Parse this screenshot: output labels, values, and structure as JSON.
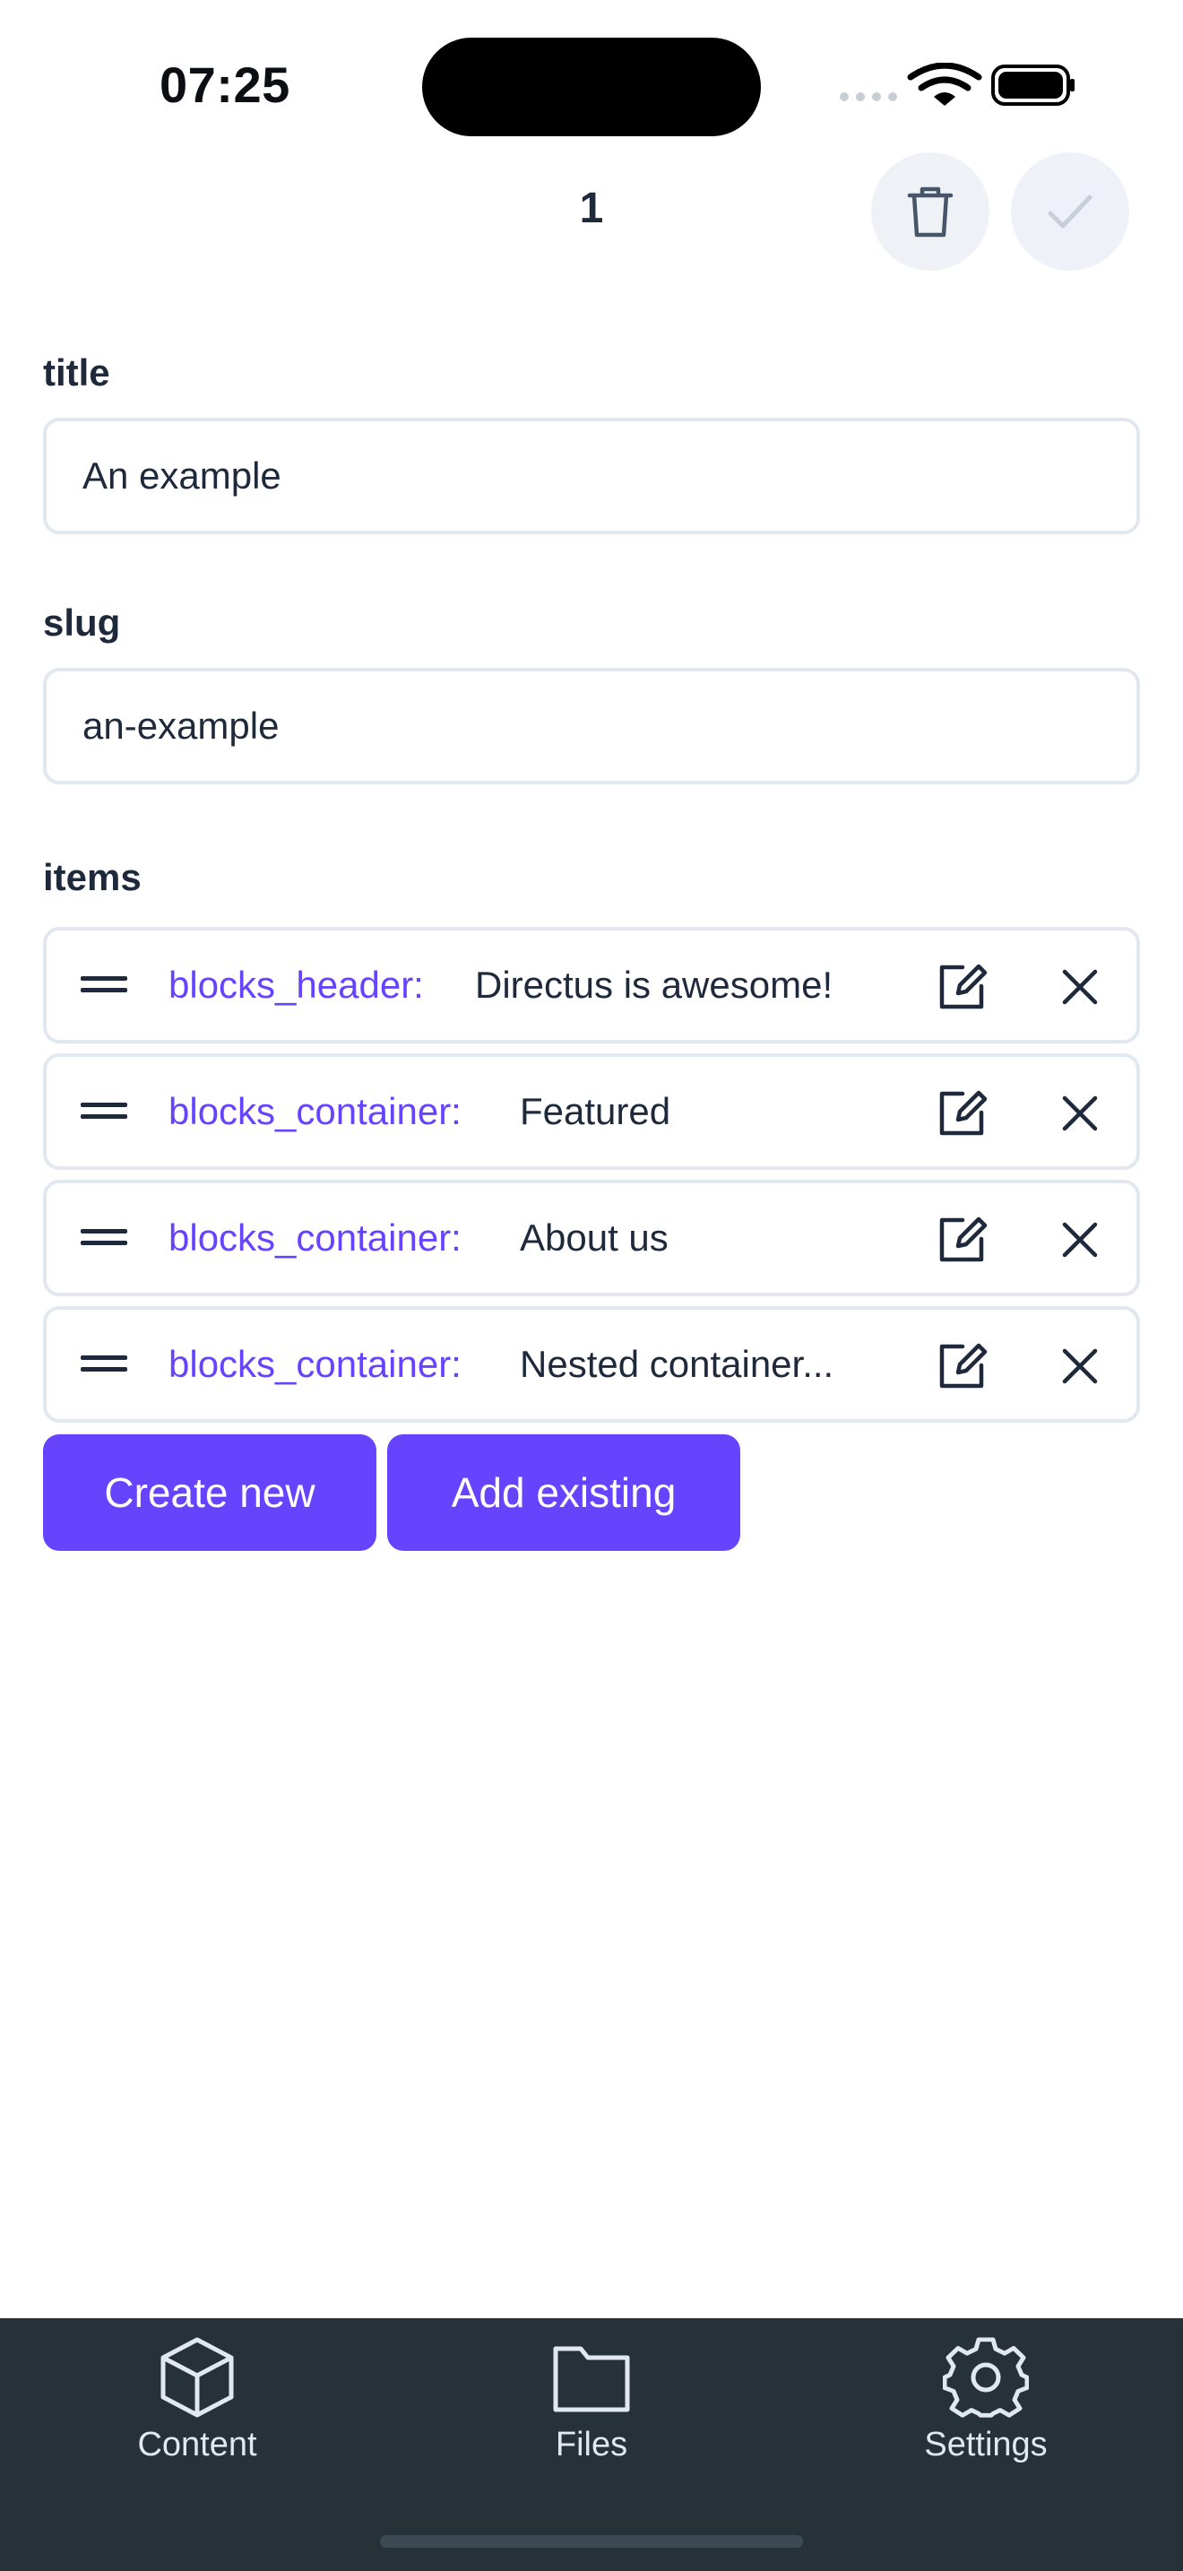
{
  "status_bar": {
    "time": "07:25",
    "icons": [
      "signal-icon",
      "wifi-icon",
      "battery-icon"
    ]
  },
  "header": {
    "title": "1",
    "actions": [
      {
        "name": "delete",
        "icon": "trash-icon"
      },
      {
        "name": "save",
        "icon": "check-icon"
      }
    ]
  },
  "form": {
    "title_field": {
      "label": "title",
      "value": "An example"
    },
    "slug_field": {
      "label": "slug",
      "value": "an-example"
    },
    "items_field": {
      "label": "items",
      "items": [
        {
          "collection": "blocks_header:",
          "title": "Directus is awesome!"
        },
        {
          "collection": "blocks_container:",
          "title": "Featured"
        },
        {
          "collection": "blocks_container:",
          "title": "About us"
        },
        {
          "collection": "blocks_container:",
          "title": "Nested container..."
        }
      ],
      "create_new_label": "Create new",
      "add_existing_label": "Add existing"
    }
  },
  "tab_bar": {
    "tabs": [
      {
        "label": "Content",
        "icon": "cube-icon"
      },
      {
        "label": "Files",
        "icon": "folder-icon"
      },
      {
        "label": "Settings",
        "icon": "gear-icon"
      }
    ]
  },
  "colors": {
    "accent": "#6644ff",
    "tab_bar_bg": "#263238",
    "text": "#1e293b",
    "border": "#e2e8f0"
  }
}
